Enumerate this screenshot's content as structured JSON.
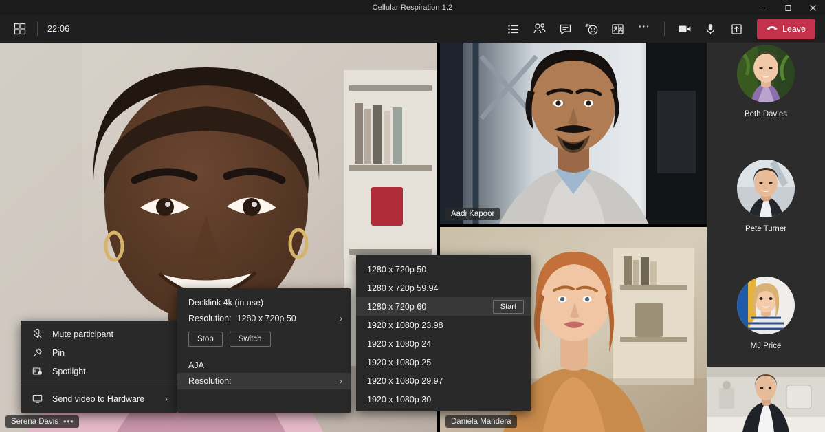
{
  "window": {
    "title": "Cellular Respiration 1.2",
    "minimize_label": "minimize-icon",
    "maximize_label": "maximize-icon",
    "close_label": "close-icon"
  },
  "toolbar": {
    "grid_icon": "grid-view-icon",
    "time": "22:06",
    "buttons": [
      {
        "name": "meeting-notes-icon",
        "label": "Meeting notes"
      },
      {
        "name": "people-icon",
        "label": "Show participants"
      },
      {
        "name": "chat-icon",
        "label": "Show conversation"
      },
      {
        "name": "reactions-icon",
        "label": "Reactions"
      },
      {
        "name": "breakout-rooms-icon",
        "label": "Breakout rooms"
      },
      {
        "name": "more-options-icon",
        "label": "More actions"
      }
    ],
    "camera_label": "Camera",
    "mic_label": "Microphone",
    "share_label": "Share content",
    "leave_label": "Leave",
    "leave_color": "#c4314b"
  },
  "stage": {
    "tiles": [
      {
        "name": "Serena Davis",
        "overflow": "•••",
        "active": false
      },
      {
        "name": "Aadi Kapoor",
        "overflow": "",
        "active": false
      },
      {
        "name": "Daniela Mandera",
        "overflow": "",
        "active": true
      }
    ],
    "active_border_color": "#7b83eb"
  },
  "roster": {
    "participants": [
      {
        "name": "Beth Davies"
      },
      {
        "name": "Pete Turner"
      },
      {
        "name": "MJ Price"
      }
    ],
    "video_thumb_name": "roster-video-thumbnail"
  },
  "participant_menu": {
    "items": [
      {
        "icon": "mic-off-icon",
        "label": "Mute participant",
        "submenu": false
      },
      {
        "icon": "pin-icon",
        "label": "Pin",
        "submenu": false
      },
      {
        "icon": "spotlight-icon",
        "label": "Spotlight",
        "submenu": false
      }
    ],
    "footer": {
      "icon": "monitor-icon",
      "label": "Send video to Hardware",
      "chevron": "›"
    }
  },
  "hardware_menu": {
    "device_title": "Decklink 4k (in use)",
    "resolution_label": "Resolution:",
    "resolution_value": "1280 x 720p 50",
    "chevron": "›",
    "stop_label": "Stop",
    "switch_label": "Switch",
    "second_device_title": "AJA",
    "second_resolution_label": "Resolution:"
  },
  "resolution_menu": {
    "options": [
      {
        "label": "1280 x 720p 50",
        "selected": false,
        "action": ""
      },
      {
        "label": "1280 x 720p 59.94",
        "selected": false,
        "action": ""
      },
      {
        "label": "1280 x 720p 60",
        "selected": true,
        "action": "Start"
      },
      {
        "label": "1920 x 1080p 23.98",
        "selected": false,
        "action": ""
      },
      {
        "label": "1920 x 1080p 24",
        "selected": false,
        "action": ""
      },
      {
        "label": "1920 x 1080p 25",
        "selected": false,
        "action": ""
      },
      {
        "label": "1920 x 1080p 29.97",
        "selected": false,
        "action": ""
      },
      {
        "label": "1920 x 1080p 30",
        "selected": false,
        "action": ""
      }
    ]
  }
}
